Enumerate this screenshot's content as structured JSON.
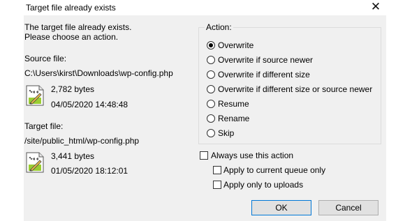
{
  "window": {
    "title": "Target file already exists",
    "close_glyph": "✕"
  },
  "message": {
    "line1": "The target file already exists.",
    "line2": "Please choose an action."
  },
  "source": {
    "label": "Source file:",
    "path": "C:\\Users\\kirst\\Downloads\\wp-config.php",
    "size": "2,782 bytes",
    "date": "04/05/2020 14:48:48",
    "icon": "text-file-icon"
  },
  "target": {
    "label": "Target file:",
    "path": "/site/public_html/wp-config.php",
    "size": "3,441 bytes",
    "date": "01/05/2020 18:12:01",
    "icon": "text-file-icon"
  },
  "action": {
    "label": "Action:",
    "options": [
      {
        "label": "Overwrite",
        "checked": true
      },
      {
        "label": "Overwrite if source newer",
        "checked": false
      },
      {
        "label": "Overwrite if different size",
        "checked": false
      },
      {
        "label": "Overwrite if different size or source newer",
        "checked": false
      },
      {
        "label": "Resume",
        "checked": false
      },
      {
        "label": "Rename",
        "checked": false
      },
      {
        "label": "Skip",
        "checked": false
      }
    ]
  },
  "checkboxes": {
    "always": {
      "label": "Always use this action",
      "checked": false
    },
    "queue_only": {
      "label": "Apply to current queue only",
      "checked": false
    },
    "uploads_only": {
      "label": "Apply only to uploads",
      "checked": false
    }
  },
  "buttons": {
    "ok": "OK",
    "cancel": "Cancel"
  },
  "colors": {
    "accent": "#0078d7",
    "button_bg": "#e1e1e1",
    "dialog_bg": "#f0f0f0"
  }
}
